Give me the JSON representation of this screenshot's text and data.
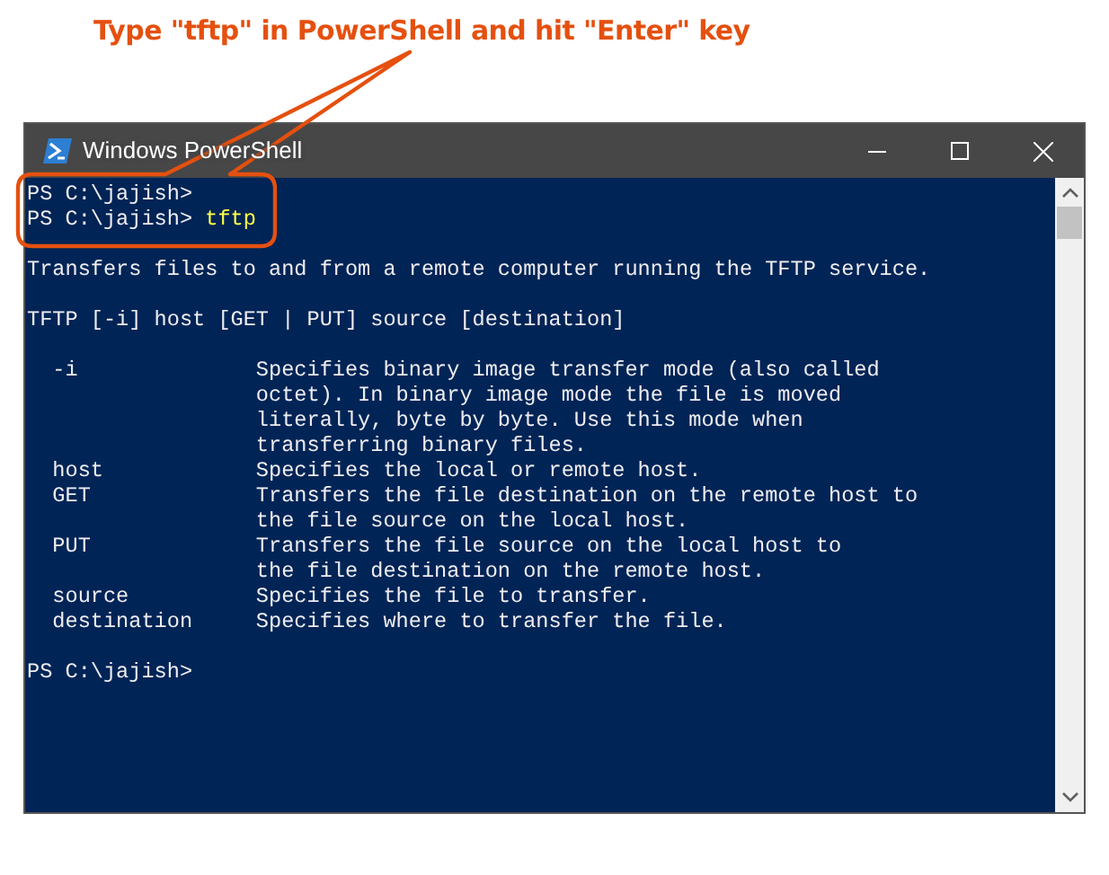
{
  "annotation": {
    "text": "Type \"tftp\" in PowerShell and hit \"Enter\" key"
  },
  "window": {
    "title": "Windows PowerShell"
  },
  "console": {
    "lines": [
      {
        "kind": "prompt",
        "prompt": "PS C:\\jajish>"
      },
      {
        "kind": "prompt",
        "prompt": "PS C:\\jajish>",
        "command": "tftp"
      },
      {
        "kind": "spacer"
      },
      {
        "kind": "text",
        "text": "Transfers files to and from a remote computer running the TFTP service."
      },
      {
        "kind": "spacer"
      },
      {
        "kind": "text",
        "text": "TFTP [-i] host [GET | PUT] source [destination]"
      },
      {
        "kind": "spacer"
      },
      {
        "kind": "option",
        "name": "-i",
        "description": [
          "Specifies binary image transfer mode (also called",
          "octet). In binary image mode the file is moved",
          "literally, byte by byte. Use this mode when",
          "transferring binary files."
        ]
      },
      {
        "kind": "option",
        "name": "host",
        "description": [
          "Specifies the local or remote host."
        ]
      },
      {
        "kind": "option",
        "name": "GET",
        "description": [
          "Transfers the file destination on the remote host to",
          "the file source on the local host."
        ]
      },
      {
        "kind": "option",
        "name": "PUT",
        "description": [
          "Transfers the file source on the local host to",
          "the file destination on the remote host."
        ]
      },
      {
        "kind": "option",
        "name": "source",
        "description": [
          "Specifies the file to transfer."
        ]
      },
      {
        "kind": "option",
        "name": "destination",
        "description": [
          "Specifies where to transfer the file."
        ]
      },
      {
        "kind": "spacer"
      },
      {
        "kind": "prompt",
        "prompt": "PS C:\\jajish>"
      }
    ]
  }
}
